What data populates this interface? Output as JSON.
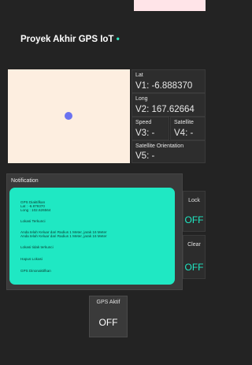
{
  "app": {
    "title": "Proyek Akhir GPS IoT",
    "title_dot": "•",
    "accent": "#1fe8c3"
  },
  "map": {
    "marker_color": "#6b72f0"
  },
  "tiles": {
    "lat": {
      "label": "Lat",
      "value": "V1: -6.888370"
    },
    "long": {
      "label": "Long",
      "value": "V2: 167.62664"
    },
    "speed": {
      "label": "Speed",
      "value": "V3: -"
    },
    "satellite": {
      "label": "Satellite",
      "value": "V4: -"
    },
    "orientation": {
      "label": "Satellite Orientation",
      "value": "V5: -"
    }
  },
  "notification": {
    "title": "Notification",
    "lines": [
      "GPS Diaktifkan",
      "Lat : -6.879370",
      "Long : 102.626564",
      "Lokasi Terkunci",
      "Anda telah Keluar dari Radius 1 Meter, jarak 16 Meter",
      "Anda telah Keluar dari Radius 1 Meter, jarak 16 Meter",
      "Lokasi tidak terkunci",
      "Hapus Lokasi",
      "GPS Dinonaktifkan"
    ]
  },
  "buttons": {
    "lock": {
      "label": "Lock",
      "value": "OFF"
    },
    "clear": {
      "label": "Clear",
      "value": "OFF"
    },
    "gps": {
      "label": "GPS Aktif",
      "value": "OFF"
    }
  }
}
